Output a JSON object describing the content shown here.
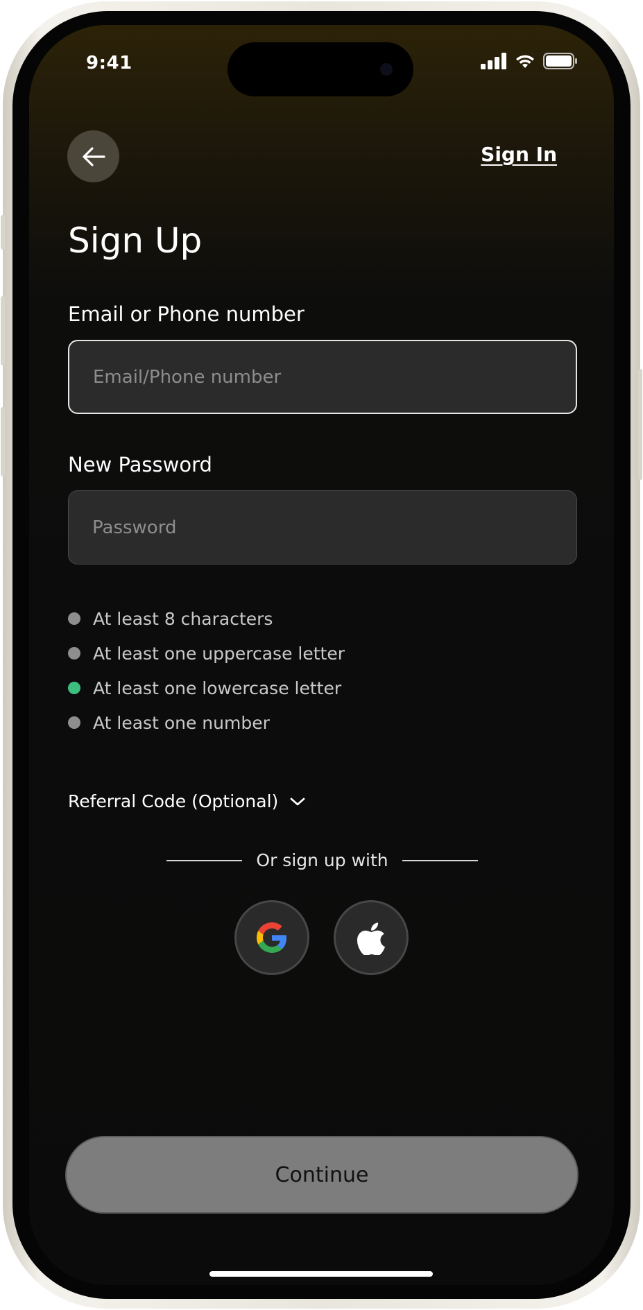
{
  "status_bar": {
    "time": "9:41",
    "icons": [
      "signal-icon",
      "wifi-icon",
      "battery-icon"
    ]
  },
  "header": {
    "back_icon": "arrow-left-icon",
    "sign_in_label": "Sign In"
  },
  "title": "Sign Up",
  "email_field": {
    "label": "Email or Phone number",
    "placeholder": "Email/Phone number",
    "value": ""
  },
  "password_field": {
    "label": "New Password",
    "placeholder": "Password",
    "value": ""
  },
  "requirements": [
    {
      "text": "At least 8 characters",
      "met": false
    },
    {
      "text": "At least one uppercase letter",
      "met": false
    },
    {
      "text": "At least one lowercase letter",
      "met": true
    },
    {
      "text": "At least one number",
      "met": false
    }
  ],
  "referral": {
    "label": "Referral Code (Optional)",
    "icon": "chevron-down-icon"
  },
  "social": {
    "divider_text": "Or sign up with",
    "providers": [
      {
        "name": "google",
        "icon": "google-icon"
      },
      {
        "name": "apple",
        "icon": "apple-icon"
      }
    ]
  },
  "continue_label": "Continue",
  "colors": {
    "requirement_met": "#3dbf80",
    "requirement_unmet": "#8e8e8e",
    "continue_bg": "#7d7d7d"
  }
}
